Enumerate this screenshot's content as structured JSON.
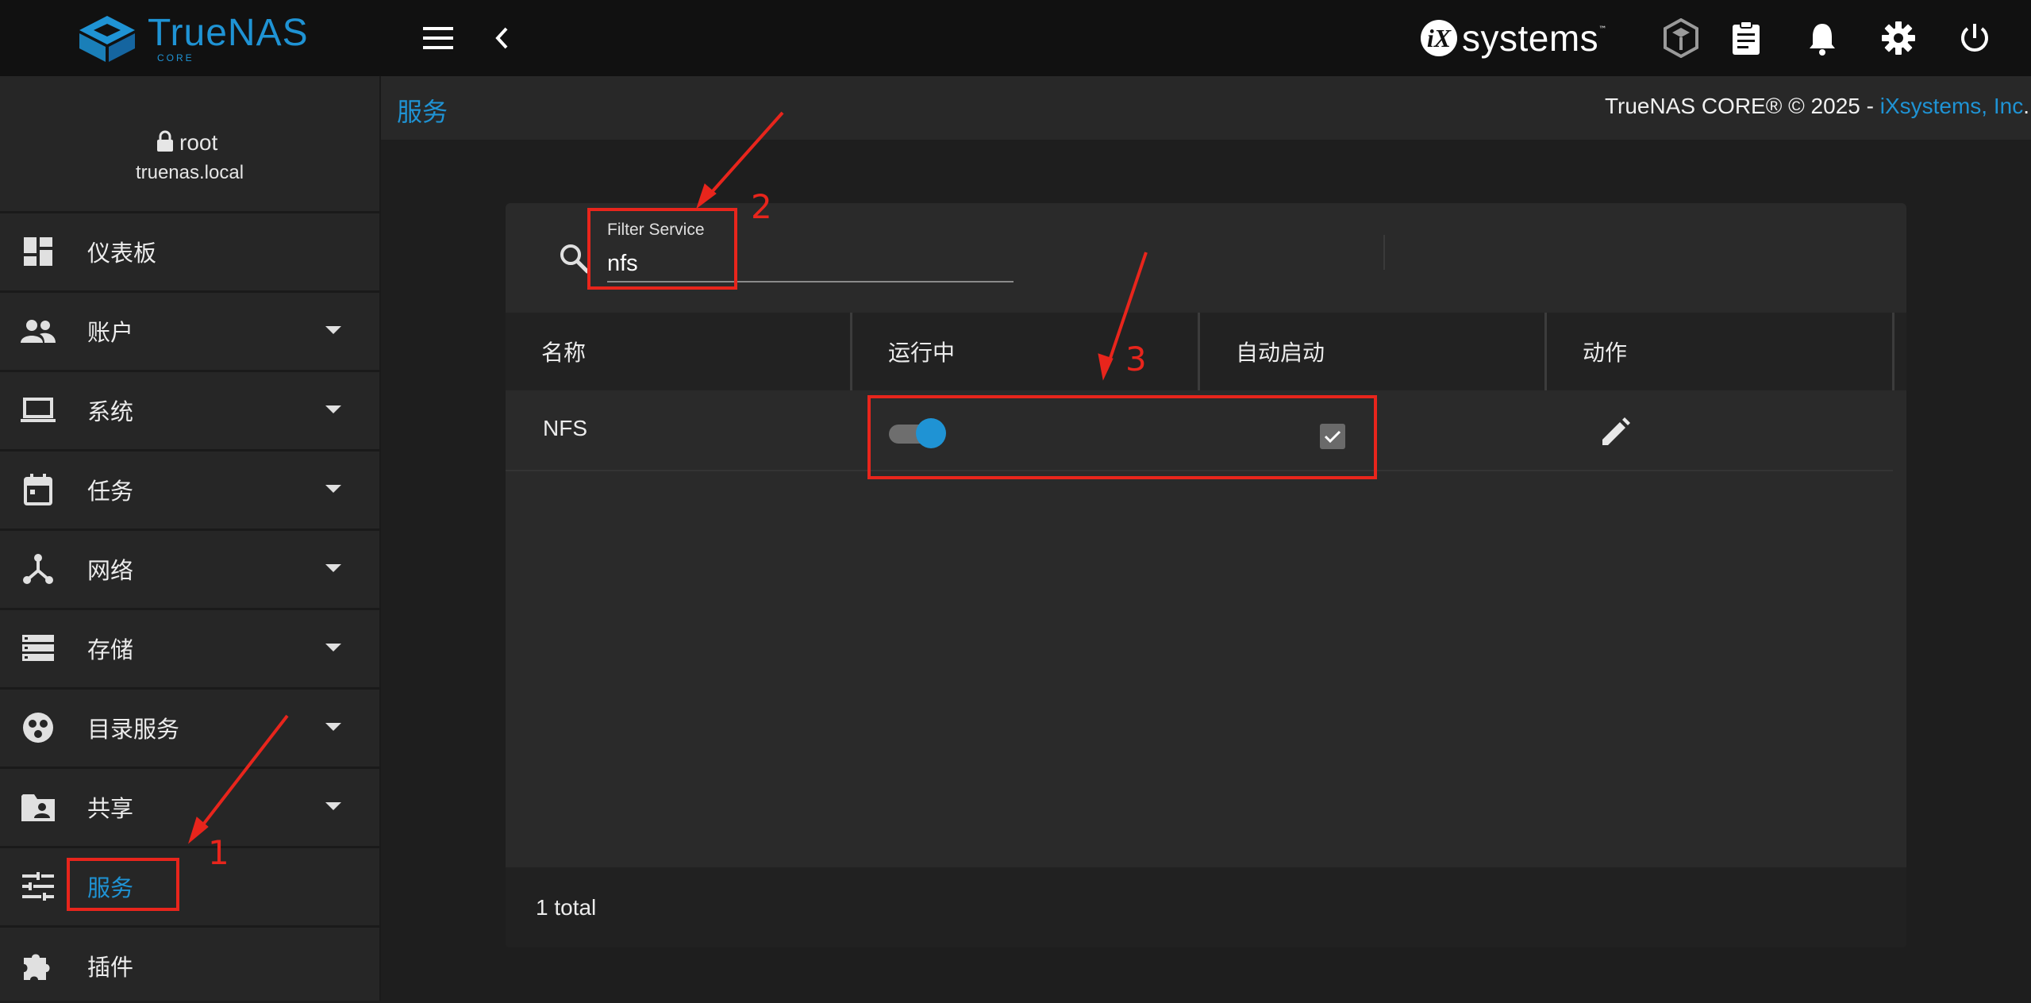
{
  "topbar": {
    "logo_text": "TrueNAS",
    "logo_sub": "CORE",
    "vendor_logo_badge": "iX",
    "vendor_logo_text": "systems",
    "vendor_logo_tm": "™",
    "icons": [
      "menu-icon",
      "back-icon",
      "truecommand-icon",
      "clipboard-icon",
      "bell-icon",
      "settings-icon",
      "power-icon"
    ]
  },
  "user": {
    "name": "root",
    "host": "truenas.local"
  },
  "sidebar": {
    "items": [
      {
        "label": "仪表板",
        "icon": "dashboard-icon",
        "has_caret": false
      },
      {
        "label": "账户",
        "icon": "people-icon",
        "has_caret": true
      },
      {
        "label": "系统",
        "icon": "laptop-icon",
        "has_caret": true
      },
      {
        "label": "任务",
        "icon": "calendar-icon",
        "has_caret": true
      },
      {
        "label": "网络",
        "icon": "network-icon",
        "has_caret": true
      },
      {
        "label": "存储",
        "icon": "storage-icon",
        "has_caret": true
      },
      {
        "label": "目录服务",
        "icon": "directory-icon",
        "has_caret": true
      },
      {
        "label": "共享",
        "icon": "shared-folder-icon",
        "has_caret": true
      },
      {
        "label": "服务",
        "icon": "tune-icon",
        "has_caret": false,
        "active": true
      },
      {
        "label": "插件",
        "icon": "puzzle-icon",
        "has_caret": false
      }
    ]
  },
  "page": {
    "title": "服务",
    "copyright_prefix": "TrueNAS CORE® © 2025 - ",
    "copyright_link": "iXsystems, Inc",
    "copyright_suffix": "."
  },
  "filter": {
    "label": "Filter Service",
    "value": "nfs"
  },
  "table": {
    "columns": [
      "名称",
      "运行中",
      "自动启动",
      "动作"
    ],
    "rows": [
      {
        "name": "NFS",
        "running": true,
        "autostart": true
      }
    ],
    "footer": "1 total"
  },
  "annotations": {
    "steps": [
      "1",
      "2",
      "3"
    ],
    "color": "#e8251c"
  },
  "colors": {
    "accent": "#1f93d4",
    "topbar": "#111111",
    "sidebar": "#262626",
    "card": "#2a2a2a"
  }
}
